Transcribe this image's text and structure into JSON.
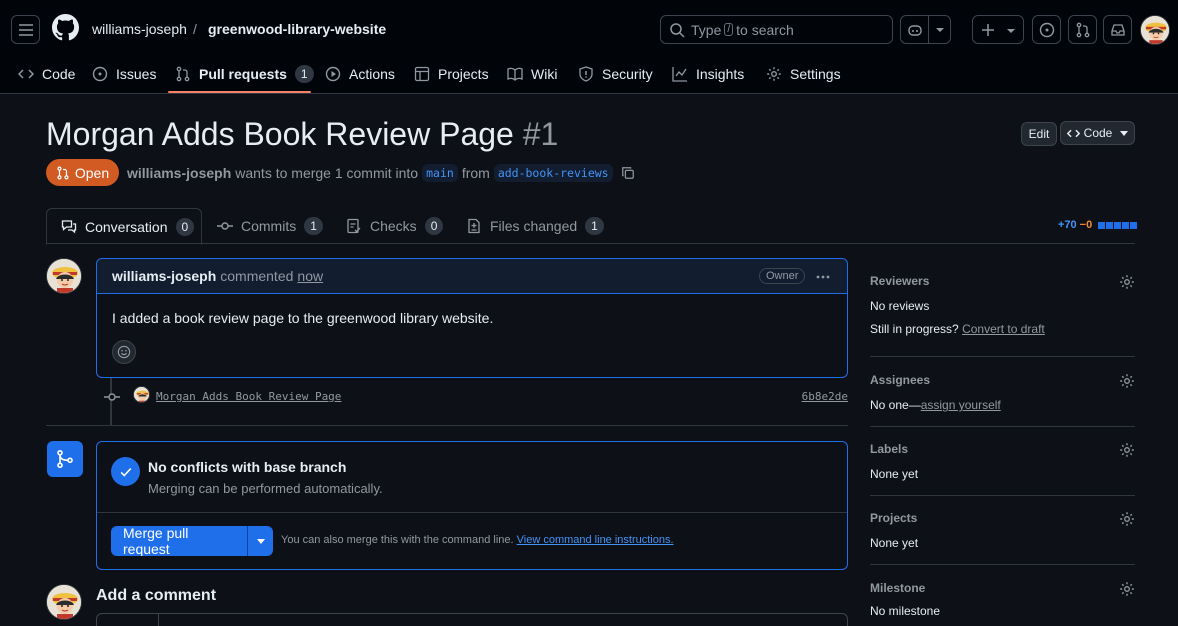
{
  "header": {
    "owner": "williams-joseph",
    "separator": "/",
    "repo": "greenwood-library-website",
    "search_prefix": "Type",
    "search_key": "/",
    "search_suffix": "to search"
  },
  "nav": {
    "code": "Code",
    "issues": "Issues",
    "pull_requests": "Pull requests",
    "pull_requests_count": "1",
    "actions": "Actions",
    "projects": "Projects",
    "wiki": "Wiki",
    "security": "Security",
    "insights": "Insights",
    "settings": "Settings"
  },
  "pr": {
    "title": "Morgan Adds Book Review Page",
    "number": "#1",
    "edit_label": "Edit",
    "code_label": "Code",
    "state": "Open",
    "author": "williams-joseph",
    "meta_text": "wants to merge 1 commit into",
    "base_branch": "main",
    "from_text": "from",
    "head_branch": "add-book-reviews"
  },
  "tabs": {
    "conversation": "Conversation",
    "conversation_count": "0",
    "commits": "Commits",
    "commits_count": "1",
    "checks": "Checks",
    "checks_count": "0",
    "files": "Files changed",
    "files_count": "1",
    "additions": "+70",
    "deletions": "−0"
  },
  "comment": {
    "author": "williams-joseph",
    "action": "commented",
    "time": "now",
    "role": "Owner",
    "body": "I added a book review page to the greenwood library website."
  },
  "commit": {
    "message": "Morgan Adds Book Review Page",
    "sha": "6b8e2de"
  },
  "merge": {
    "title": "No conflicts with base branch",
    "subtitle": "Merging can be performed automatically.",
    "button": "Merge pull request",
    "hint": "You can also merge this with the command line.",
    "link": "View command line instructions."
  },
  "add_comment": {
    "title": "Add a comment"
  },
  "sidebar": {
    "reviewers_title": "Reviewers",
    "reviewers_value": "No reviews",
    "reviewers_progress": "Still in progress?",
    "convert_link": "Convert to draft",
    "assignees_title": "Assignees",
    "assignees_value": "No one—",
    "assign_link": "assign yourself",
    "labels_title": "Labels",
    "labels_value": "None yet",
    "projects_title": "Projects",
    "projects_value": "None yet",
    "milestone_title": "Milestone",
    "milestone_value": "No milestone"
  },
  "colors": {
    "accent": "#1f6feb",
    "open_state": "#d15b22",
    "underline": "#f78166",
    "background": "#0d1117"
  }
}
